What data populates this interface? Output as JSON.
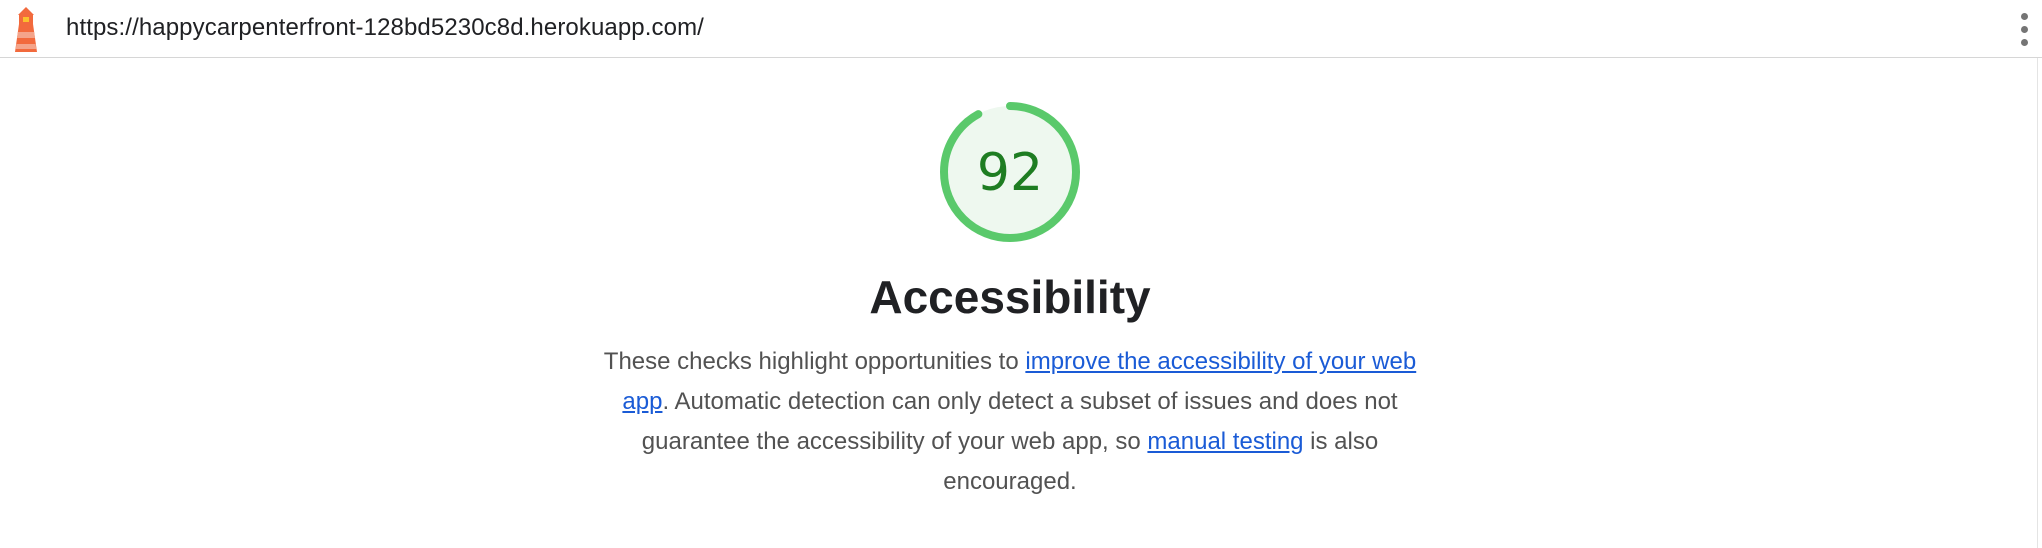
{
  "topbar": {
    "url": "https://happycarpenterfront-128bd5230c8d.herokuapp.com/",
    "logo_icon": "lighthouse-icon",
    "menu_icon": "more-vertical-icon"
  },
  "score": {
    "value": "92",
    "fraction": 0.92,
    "ring_color": "#5ac96b",
    "fill_color": "#eef8ef",
    "text_color": "#1e7d22"
  },
  "category": {
    "title": "Accessibility"
  },
  "description": {
    "part1": "These checks highlight opportunities to ",
    "link1": "improve the accessibility of your web app",
    "part2": ". Automatic detection can only detect a subset of issues and does not guarantee the accessibility of your web app, so ",
    "link2": "manual testing",
    "part3": " is also encouraged."
  },
  "colors": {
    "link": "#1a5bd6",
    "logo_orange": "#f26a3d",
    "logo_yellow": "#fbc02d"
  }
}
